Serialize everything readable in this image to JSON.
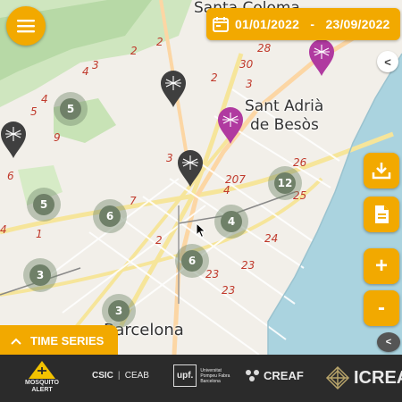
{
  "map": {
    "place_labels": [
      "Sant Adrià",
      "de Besòs",
      "Barcelona",
      "Santa Coloma"
    ],
    "road_numbers": [
      "2",
      "2",
      "2",
      "4",
      "3",
      "4",
      "5",
      "6",
      "9",
      "3",
      "7",
      "1",
      "4",
      "2",
      "3",
      "4",
      "28",
      "30",
      "207",
      "26",
      "25",
      "24",
      "23",
      "23",
      "23"
    ],
    "clusters": [
      {
        "count": "5"
      },
      {
        "count": "5"
      },
      {
        "count": "6"
      },
      {
        "count": "3"
      },
      {
        "count": "4"
      },
      {
        "count": "12"
      },
      {
        "count": "6"
      },
      {
        "count": "3"
      }
    ],
    "pins": [
      {
        "kind": "mosquito-dark",
        "color": "#3f3f3f"
      },
      {
        "kind": "mosquito-dark",
        "color": "#3f3f3f"
      },
      {
        "kind": "mosquito-dark",
        "color": "#3f3f3f"
      },
      {
        "kind": "mosquito-purple",
        "color": "#b03aa0"
      },
      {
        "kind": "mosquito-purple",
        "color": "#b03aa0"
      }
    ]
  },
  "header": {
    "menu_icon": "hamburger-icon",
    "date_range": "01/01/2022   -   23/09/2022",
    "calendar_icon": "calendar-icon"
  },
  "controls": {
    "collapse_top_label": "<",
    "collapse_bottom_label": "<",
    "download_icon": "download-icon",
    "document_icon": "document-icon",
    "zoom_in_label": "+",
    "zoom_out_label": "-"
  },
  "time_series": {
    "label": "TIME SERIES",
    "icon": "chevron-up-icon"
  },
  "footer": {
    "logos": [
      {
        "name": "MOSQUITO",
        "sub": "ALERT"
      },
      {
        "name": "CSIC",
        "sub": "CEAB"
      },
      {
        "name": "upf.",
        "sub": "Universitat Pompeu Fabra Barcelona"
      },
      {
        "name": "CREAF"
      },
      {
        "name": "ICREA"
      }
    ]
  },
  "colors": {
    "accent": "#f2a900",
    "footer_bg": "#2b2b2b",
    "sea": "#aad3df",
    "cluster": "#6f8068"
  }
}
